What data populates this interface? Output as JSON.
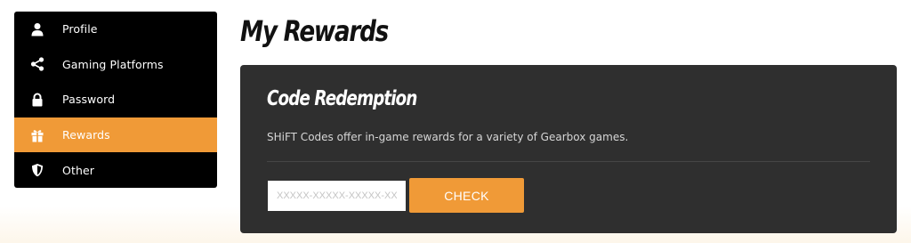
{
  "sidebar": {
    "items": [
      {
        "label": "Profile",
        "icon": "user-icon",
        "active": false
      },
      {
        "label": "Gaming Platforms",
        "icon": "share-icon",
        "active": false
      },
      {
        "label": "Password",
        "icon": "lock-icon",
        "active": false
      },
      {
        "label": "Rewards",
        "icon": "gift-icon",
        "active": true
      },
      {
        "label": "Other",
        "icon": "shield-icon",
        "active": false
      }
    ],
    "active_color": "#f09a37",
    "background_color": "#000000"
  },
  "page": {
    "title": "My Rewards"
  },
  "code_redemption": {
    "title": "Code Redemption",
    "description": "SHiFT Codes offer in-game rewards for a variety of Gearbox games.",
    "input_placeholder": "XXXXX-XXXXX-XXXXX-XXXXX-XXXXX",
    "input_value": "",
    "check_label": "CHECK",
    "accent_color": "#f09a37",
    "card_color": "#2f2f2f"
  }
}
